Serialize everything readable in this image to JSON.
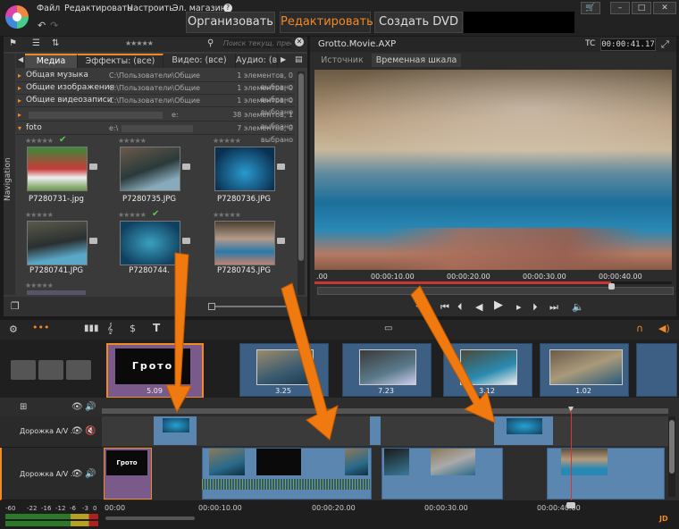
{
  "menu": {
    "file": "Файл",
    "edit": "Редактировать",
    "settings": "Настроить",
    "store": "Эл. магазин",
    "help": "?"
  },
  "main_tabs": {
    "organize": "Организовать",
    "edit": "Редактировать",
    "dvd": "Создать DVD"
  },
  "library": {
    "search_placeholder": "Поиск текущ. прес",
    "tabs": [
      "Медиа",
      "Эффекты: (все)",
      "Видео: (все)",
      "Аудио: (все)"
    ],
    "nav_label": "Navigation",
    "groups": [
      {
        "name": "Общая музыка",
        "path": "C:\\Пользователи\\Общие",
        "count": "1 элементов, 0 выбрано"
      },
      {
        "name": "Общие изображения",
        "path": "C:\\Пользователи\\Общие",
        "count": "1 элементов, 0 выбрано"
      },
      {
        "name": "Общие видеозаписи",
        "path": "C:\\Пользователи\\Общие",
        "count": "1 элементов, 0 выбрано"
      },
      {
        "name": "",
        "path": "e:",
        "count": "38 элементов, 1 выбрано"
      },
      {
        "name": "foto",
        "path": "e:\\",
        "count": "7 элементов, 0 выбрано"
      }
    ],
    "items": [
      {
        "caption": "P7280731-.jpg",
        "checked": true
      },
      {
        "caption": "P7280735.JPG",
        "checked": false
      },
      {
        "caption": "P7280736.JPG",
        "checked": false
      },
      {
        "caption": "P7280741.JPG",
        "checked": false
      },
      {
        "caption": "P7280744.",
        "checked": true
      },
      {
        "caption": "P7280745.JPG",
        "checked": false
      }
    ],
    "stars": "★★★★★"
  },
  "viewer": {
    "title": "Grotto.Movie.AXP",
    "tc_label": "TC",
    "timecode": "00:00:41.17",
    "tabs": [
      "Источник",
      "Временная шкала"
    ],
    "ruler": [
      ".00",
      "00:00:10.00",
      "00:00:20.00",
      "00:00:30.00",
      "00:00:40.00"
    ]
  },
  "storyboard": {
    "clips": [
      {
        "duration": "5.09",
        "title_text": "Грото"
      },
      {
        "duration": "3.25"
      },
      {
        "duration": "7.23"
      },
      {
        "duration": "3.12"
      },
      {
        "duration": "1.02"
      }
    ]
  },
  "tracks": [
    {
      "name": "Дорожка A/V ..."
    },
    {
      "name": "Дорожка A/V ..."
    }
  ],
  "timeline_ruler": [
    "00:00",
    "00:00:10.00",
    "00:00:20.00",
    "00:00:30.00",
    "00:00:40.00"
  ],
  "vu": [
    "-60",
    "-22",
    "-16",
    "-12",
    "-6",
    "-3",
    "0"
  ],
  "brand": "JD",
  "colors": {
    "accent": "#f08a24",
    "arrow": "#f07a10",
    "clip": "#5b86b0"
  }
}
